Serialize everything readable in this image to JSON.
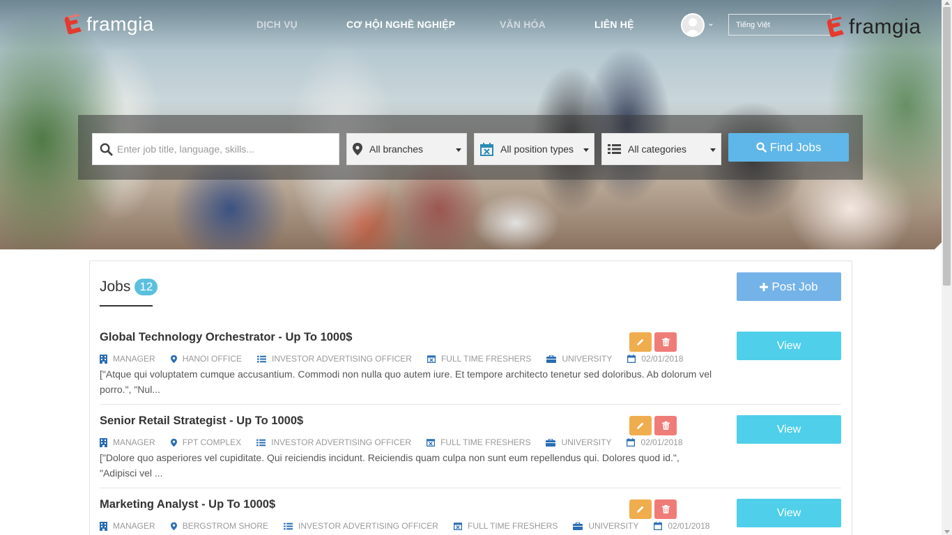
{
  "header": {
    "logo_text": "framgia",
    "nav": [
      "DỊCH VỤ",
      "CƠ HỘI NGHỀ NGHIỆP",
      "VĂN HÓA",
      "LIÊN HỆ"
    ],
    "language": "Tiếng Việt",
    "right_logo_text": "framgia"
  },
  "search": {
    "placeholder": "Enter job title, language, skills...",
    "branches": "All branches",
    "position_types": "All position types",
    "categories": "All categories",
    "find_label": "Find Jobs"
  },
  "jobs": {
    "title": "Jobs",
    "count": "12",
    "post_label": "Post Job",
    "view_label": "View",
    "items": [
      {
        "title": "Global Technology Orchestrator - Up To 1000$",
        "level": "MANAGER",
        "branch": "HANOI OFFICE",
        "category": "INVESTOR ADVERTISING OFFICER",
        "type": "FULL TIME FRESHERS",
        "education": "UNIVERSITY",
        "date": "02/01/2018",
        "desc": "[\"Atque qui voluptatem cumque accusantium. Commodi non nulla quo autem iure. Et tempore architecto tenetur sed doloribus. Ab dolorum vel porro.\", \"Nul..."
      },
      {
        "title": "Senior Retail Strategist - Up To 1000$",
        "level": "MANAGER",
        "branch": "FPT COMPLEX",
        "category": "INVESTOR ADVERTISING OFFICER",
        "type": "FULL TIME FRESHERS",
        "education": "UNIVERSITY",
        "date": "02/01/2018",
        "desc": "[\"Dolore quo asperiores vel cupiditate. Qui reiciendis incidunt. Reiciendis quam culpa non sunt eum repellendus qui. Dolores quod id.\", \"Adipisci vel ..."
      },
      {
        "title": "Marketing Analyst - Up To 1000$",
        "level": "MANAGER",
        "branch": "BERGSTROM SHORE",
        "category": "INVESTOR ADVERTISING OFFICER",
        "type": "FULL TIME FRESHERS",
        "education": "UNIVERSITY",
        "date": "02/01/2018",
        "desc": ""
      }
    ]
  },
  "colors": {
    "primary": "#5bc0de",
    "post": "#74b3e8",
    "edit": "#f0ad4e",
    "delete": "#f07c78",
    "meta_icon": "#2a6db5",
    "logo_red": "#e53a2f"
  }
}
